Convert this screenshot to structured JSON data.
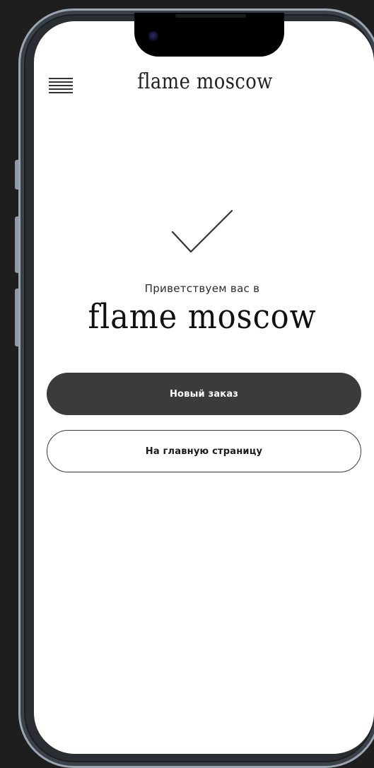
{
  "header": {
    "menu_icon": "hamburger-menu-icon",
    "logo_text": "flame moscow"
  },
  "confirmation": {
    "icon": "checkmark-icon",
    "welcome_text": "Приветствуем вас в",
    "brand_text": "flame moscow"
  },
  "actions": {
    "new_order_label": "Новый заказ",
    "home_label": "На главную страницу"
  },
  "colors": {
    "primary_button": "#3b3b3b",
    "background": "#ffffff",
    "text": "#222222"
  }
}
